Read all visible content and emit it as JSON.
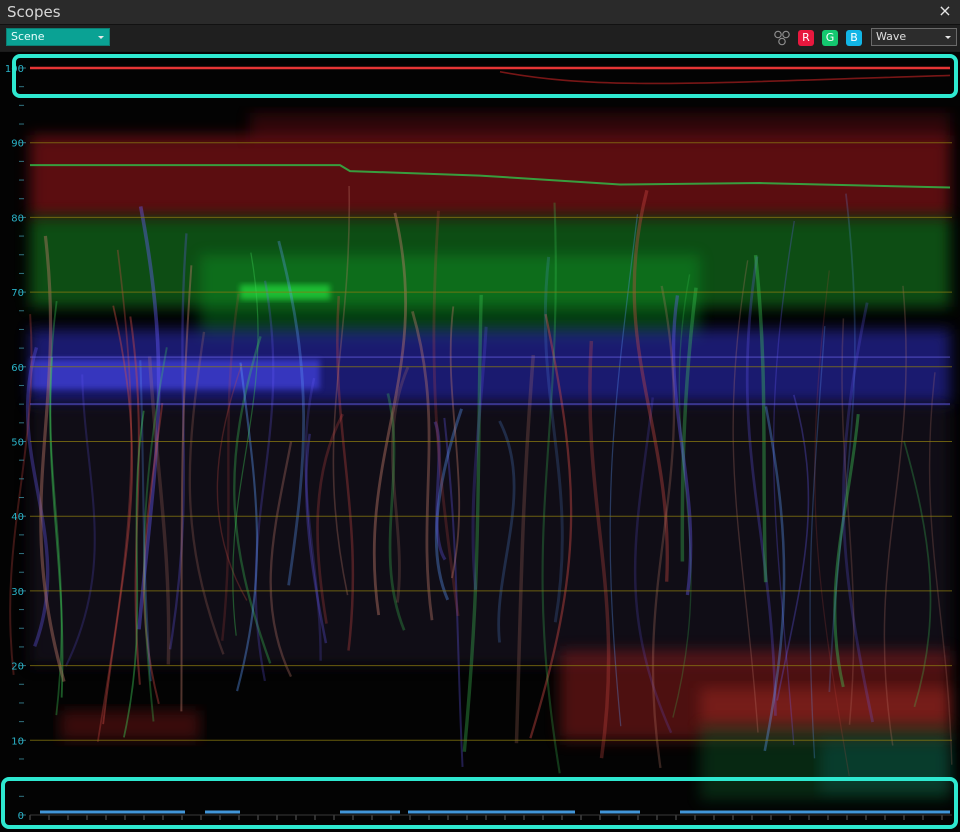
{
  "window": {
    "title": "Scopes",
    "close_glyph": "×"
  },
  "toolbar": {
    "scene_dropdown": {
      "value": "Scene"
    },
    "channels": [
      {
        "label": "R",
        "color": "#e8183e"
      },
      {
        "label": "G",
        "color": "#14c86f"
      },
      {
        "label": "B",
        "color": "#12b5e6"
      }
    ],
    "mode_dropdown": {
      "value": "Wave"
    },
    "overlay_icon": "channel-overlay-icon"
  },
  "scope": {
    "axis_labels": [
      "0",
      "10",
      "20",
      "30",
      "40",
      "50",
      "60",
      "70",
      "80",
      "90",
      "100"
    ],
    "gridline_color": "#8a7a10",
    "highlight_color": "#2ee8d0"
  }
}
